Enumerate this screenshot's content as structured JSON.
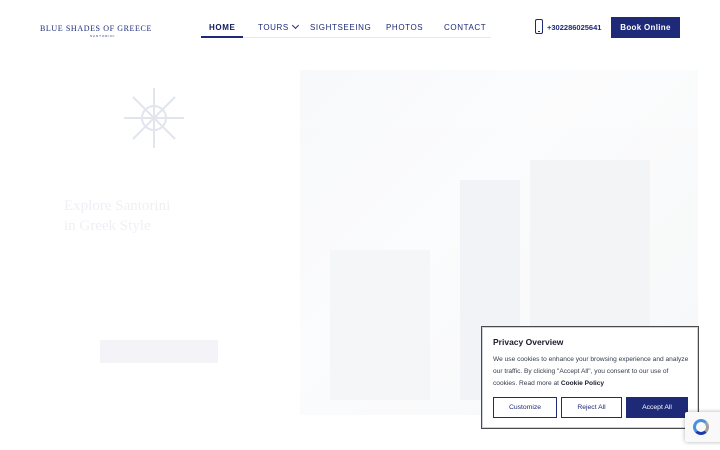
{
  "brand": {
    "name": "BLUE SHADES OF GREECE",
    "sub": "SANTORINI"
  },
  "nav": {
    "items": [
      {
        "label": "HOME",
        "active": true
      },
      {
        "label": "TOURS",
        "active": false
      },
      {
        "label": "SIGHTSEEING",
        "active": false
      },
      {
        "label": "PHOTOS",
        "active": false
      },
      {
        "label": "CONTACT",
        "active": false
      }
    ]
  },
  "contact": {
    "phone": "+302286025641"
  },
  "cta": {
    "book_label": "Book Online"
  },
  "hero": {
    "title_line1": "Explore Santorini",
    "title_line2": "in Greek Style"
  },
  "privacy": {
    "title": "Privacy Overview",
    "text": "We use cookies to enhance your browsing experience and analyze our traffic. By clicking \"Accept All\", you consent to our use of cookies. Read more at",
    "link": "Cookie Policy",
    "customize_label": "Customize",
    "reject_label": "Reject All",
    "accept_label": "Accept All"
  },
  "colors": {
    "brand": "#1e2a78",
    "text": "#333a4a"
  },
  "icons": {
    "phone": "phone-icon",
    "dropdown": "chevron-down-icon",
    "recaptcha": "recaptcha-icon"
  }
}
